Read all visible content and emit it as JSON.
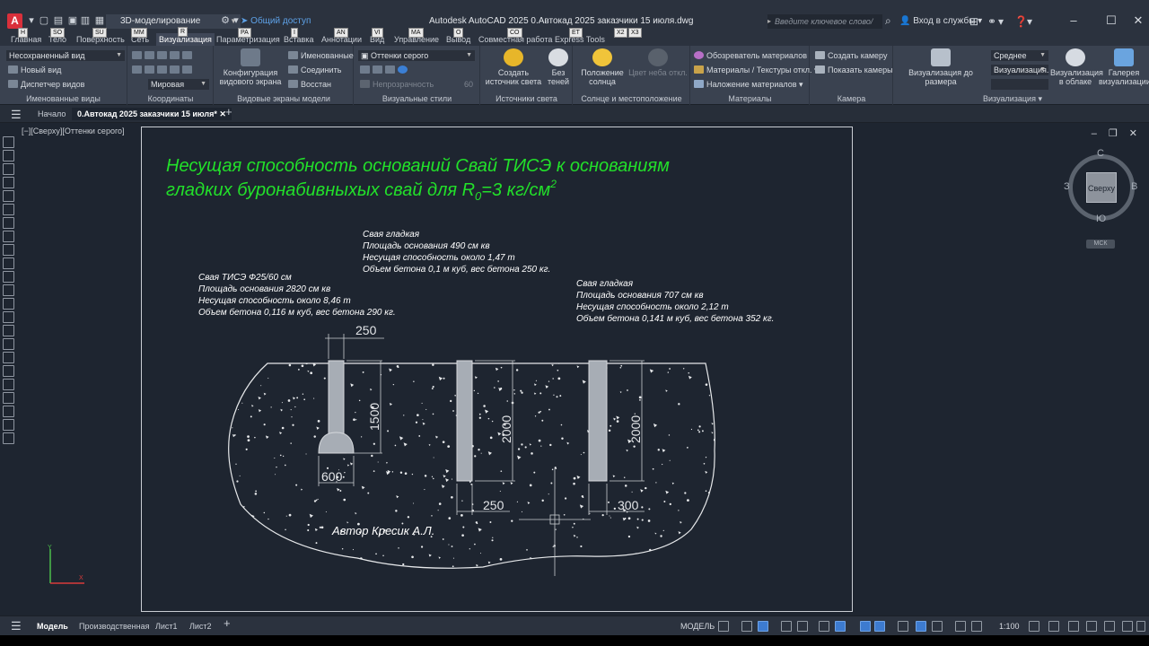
{
  "titlebar": {
    "app_logo": "A",
    "workspace": "3D-моделирование",
    "share": "Общий доступ",
    "document_title": "Autodesk AutoCAD 2025    0.Автокад 2025 заказчики 15 июля.dwg",
    "search_placeholder": "Введите ключевое слово/фразу",
    "login": "Вход в службы",
    "minimize": "–",
    "maximize": "☐",
    "close": "✕"
  },
  "ribbon_tabs": [
    {
      "label": "Главная",
      "keytip": "H"
    },
    {
      "label": "Тело",
      "keytip": "SO"
    },
    {
      "label": "Поверхность",
      "keytip": "SU"
    },
    {
      "label": "Сеть",
      "keytip": "MM"
    },
    {
      "label": "Визуализация",
      "keytip": "R"
    },
    {
      "label": "Параметризация",
      "keytip": "PA"
    },
    {
      "label": "Вставка",
      "keytip": "I"
    },
    {
      "label": "Аннотации",
      "keytip": "AN"
    },
    {
      "label": "Вид",
      "keytip": "VI"
    },
    {
      "label": "Управление",
      "keytip": "MA"
    },
    {
      "label": "Вывод",
      "keytip": "O"
    },
    {
      "label": "Совместная работа",
      "keytip": "CO"
    },
    {
      "label": "Express Tools",
      "keytip": "ET"
    },
    {
      "label": "",
      "keytip": "X2"
    },
    {
      "label": "",
      "keytip": "X3"
    }
  ],
  "ribbon_panels": {
    "named_views": {
      "label": "Именованные виды",
      "view_combo": "Несохраненный вид",
      "new_view": "Новый вид",
      "view_manager": "Диспетчер видов"
    },
    "coordinates": {
      "label": "Координаты",
      "ucs_combo": "Мировая"
    },
    "viewport_models": {
      "label": "Видовые экраны модели",
      "config_line1": "Конфигурация",
      "config_line2": "видового экрана",
      "named": "Именованные",
      "join": "Соединить",
      "restore": "Восстан"
    },
    "visual_styles": {
      "label": "Визуальные стили",
      "style_combo": "Оттенки серого",
      "opacity_label": "Непрозрачность",
      "opacity_value": "60"
    },
    "lights": {
      "label": "Источники света",
      "create_line1": "Создать",
      "create_line2": "источник света",
      "no_shadows_line1": "Без",
      "no_shadows_line2": "теней"
    },
    "sun": {
      "label": "Солнце и местоположение",
      "sun_position_line1": "Положение",
      "sun_position_line2": "солнца",
      "sky_line1": "Цвет неба откл."
    },
    "materials": {
      "label": "Материалы",
      "browser": "Обозреватель материалов",
      "textures": "Материалы / Текстуры откл.",
      "mapping": "Наложение материалов"
    },
    "camera": {
      "label": "Камера",
      "create": "Создать камеру",
      "show": "Показать камеры"
    },
    "render": {
      "label": "Визуализация",
      "render_to_size": "Визуализация до размера",
      "quality_combo": "Среднее",
      "preset_combo": "Визуализация...",
      "cloud_line1": "Визуализация",
      "cloud_line2": "в облаке",
      "gallery_line1": "Галерея",
      "gallery_line2": "визуализации"
    }
  },
  "file_tabs": {
    "start": "Начало",
    "active": "0.Автокад 2025 заказчики 15 июля*",
    "close": "✕",
    "add": "+"
  },
  "viewport": {
    "label": "[−][Сверху][Оттенки серого]",
    "viewcube": {
      "face": "Сверху",
      "north": "С",
      "south": "Ю",
      "west": "З",
      "east": "В"
    },
    "wcs": "МСК"
  },
  "drawing": {
    "title_line1": "Несущая способность оснований Свай ТИСЭ к основаниям",
    "title_line2": "гладких буронабивныхых свай для R",
    "title_subscript": "0",
    "title_line2_tail": "=3 кг/см",
    "title_superscript": "2",
    "pile_left": {
      "line1": "Свая ТИСЭ Ф25/60 см",
      "line2": "Площадь основания 2820 см кв",
      "line3": "Несущая способность около 8,46 т",
      "line4": "Объем бетона 0,116 м куб, вес бетона 290 кг."
    },
    "pile_middle": {
      "line1": "Свая гладкая",
      "line2": "Площадь основания 490 см кв",
      "line3": "Несущая способность около 1,47 т",
      "line4": "Объем бетона 0,1 м куб, вес бетона 250 кг."
    },
    "pile_right": {
      "line1": "Свая гладкая",
      "line2": "Площадь основания 707 см кв",
      "line3": "Несущая способность около 2,12 т",
      "line4": "Объем бетона 0,141 м куб, вес бетона 352 кг."
    },
    "dims": {
      "d250_top": "250",
      "d1500": "1500",
      "d600": "600",
      "d2000_mid": "2000",
      "d2000_right": "2000",
      "d250_bottom": "250",
      "d300": "300"
    },
    "author": "Автор Кресик А.Л.",
    "colors": {
      "title": "#22e02a",
      "text": "#ffffff",
      "pile_fill": "#a7adb5",
      "soil_stroke": "#e6e8ea",
      "dim_line": "#c9ccd0"
    }
  },
  "layout_tabs": {
    "model": "Модель",
    "production": "Производственная",
    "sheet1": "Лист1",
    "sheet2": "Лист2",
    "add": "+"
  },
  "statusbar": {
    "mode": "МОДЕЛЬ",
    "scale": "1:100"
  }
}
